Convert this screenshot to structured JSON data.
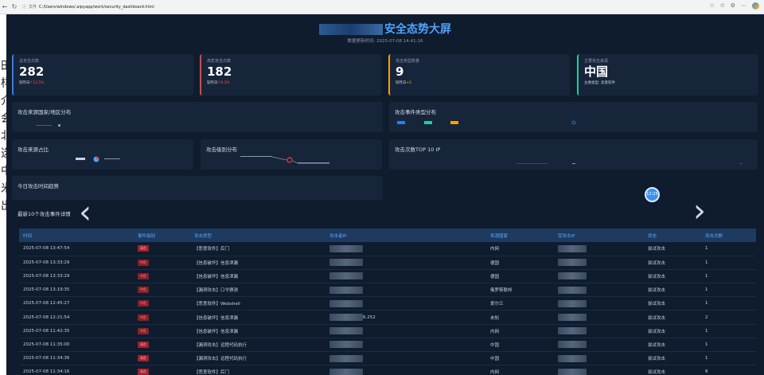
{
  "browser": {
    "url_info": "文件",
    "url": "C:/Users/windows/.aipyapp/work/security_dashboard.html"
  },
  "background_text": [
    "田",
    "样",
    "介",
    "会",
    "北",
    "选",
    "中",
    "米",
    "出"
  ],
  "dashboard": {
    "title": "安全态势大屏",
    "subtitle": "数据更新时间: 2025-07-08 14:41:16",
    "stats": [
      {
        "label": "总攻击次数",
        "value": "282",
        "cmp_prefix": "较昨日",
        "cmp_value": "↑12.5%",
        "accent": "#2f7ee8"
      },
      {
        "label": "高危攻击次数",
        "value": "182",
        "cmp_prefix": "较昨日",
        "cmp_value": "↑8.3%",
        "accent": "#e8423f"
      },
      {
        "label": "攻击类型数量",
        "value": "9",
        "cmp_prefix": "较昨日",
        "cmp_value": "+2",
        "accent": "#f0a020"
      },
      {
        "label": "主要攻击来源",
        "value": "中国",
        "cmp_prefix": "主要类型: 恶意软件",
        "cmp_value": "",
        "accent": "#2ec4a0"
      }
    ],
    "panels": {
      "geo": "攻击来源国家/地区分布",
      "types": "攻击事件类型分布",
      "source_ratio": "攻击来源占比",
      "severity": "攻击级别分布",
      "top_ip": "攻击次数TOP 10 IP",
      "trend": "今日攻击时间趋势"
    },
    "trend_bubble": "12:25",
    "events": {
      "title": "最新10个攻击事件详情",
      "columns": [
        "时间",
        "事件级别",
        "攻击类型",
        "攻击者IP",
        "来源国家",
        "受攻击IP",
        "状态",
        "攻击次数"
      ],
      "rows": [
        {
          "time": "2025-07-08 13:47:54",
          "level": "高危",
          "type": "【恶意软件】后门",
          "src_ip_suffix": "",
          "country": "内网",
          "status": "尝试攻击",
          "count": "1"
        },
        {
          "time": "2025-07-08 13:33:29",
          "level": "中危",
          "type": "【信息破坏】信息泄漏",
          "src_ip_suffix": "",
          "country": "德国",
          "status": "尝试攻击",
          "count": "1"
        },
        {
          "time": "2025-07-08 13:33:29",
          "level": "中危",
          "type": "【信息破坏】信息泄漏",
          "src_ip_suffix": "",
          "country": "德国",
          "status": "尝试攻击",
          "count": "1"
        },
        {
          "time": "2025-07-08 13:19:35",
          "level": "中危",
          "type": "【漏洞攻击】口令猜测",
          "src_ip_suffix": "",
          "country": "俄罗斯联邦",
          "status": "尝试攻击",
          "count": "1"
        },
        {
          "time": "2025-07-08 12:45:27",
          "level": "中危",
          "type": "【恶意软件】Webshell",
          "src_ip_suffix": "",
          "country": "爱尔兰",
          "status": "尝试攻击",
          "count": "1"
        },
        {
          "time": "2025-07-08 12:21:54",
          "level": "中危",
          "type": "【信息破坏】信息泄漏",
          "src_ip_suffix": "6.252",
          "country": "未知",
          "status": "尝试攻击",
          "count": "2"
        },
        {
          "time": "2025-07-08 11:42:35",
          "level": "中危",
          "type": "【信息破坏】信息泄漏",
          "src_ip_suffix": "",
          "country": "内网",
          "status": "尝试攻击",
          "count": "1"
        },
        {
          "time": "2025-07-08 11:35:00",
          "level": "高危",
          "type": "【漏洞攻击】远程代码执行",
          "src_ip_suffix": "",
          "country": "中国",
          "status": "尝试攻击",
          "count": "1"
        },
        {
          "time": "2025-07-08 11:34:36",
          "level": "高危",
          "type": "【漏洞攻击】远程代码执行",
          "src_ip_suffix": "",
          "country": "中国",
          "status": "尝试攻击",
          "count": "1"
        },
        {
          "time": "2025-07-08 11:34:16",
          "level": "高危",
          "type": "【恶意软件】后门",
          "src_ip_suffix": "",
          "country": "内网",
          "status": "尝试攻击",
          "count": "8"
        }
      ]
    }
  }
}
